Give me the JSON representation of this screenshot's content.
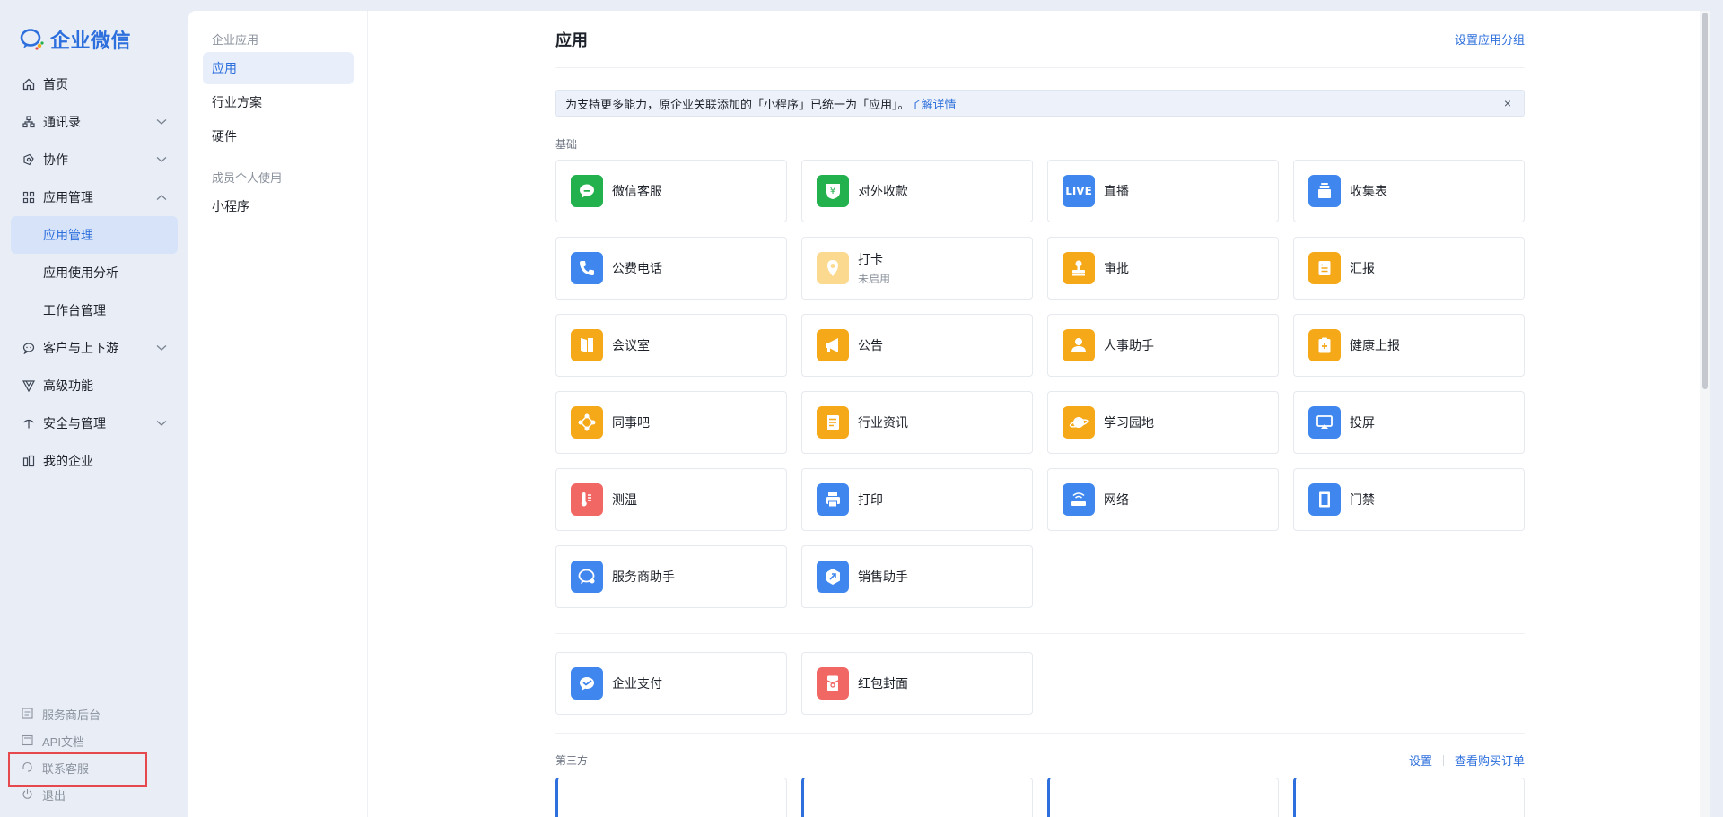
{
  "app": {
    "logo_text": "企业微信"
  },
  "sidebar": {
    "items": [
      {
        "label": "首页",
        "icon": "home-icon"
      },
      {
        "label": "通讯录",
        "icon": "contacts-icon",
        "expandable": true
      },
      {
        "label": "协作",
        "icon": "collaboration-icon",
        "expandable": true
      },
      {
        "label": "应用管理",
        "icon": "apps-icon",
        "expandable": true,
        "expanded": true
      },
      {
        "label": "应用管理",
        "sub": true,
        "active": true
      },
      {
        "label": "应用使用分析",
        "sub": true
      },
      {
        "label": "工作台管理",
        "sub": true
      },
      {
        "label": "客户与上下游",
        "icon": "customer-icon",
        "expandable": true
      },
      {
        "label": "高级功能",
        "icon": "advanced-icon"
      },
      {
        "label": "安全与管理",
        "icon": "security-icon",
        "expandable": true
      },
      {
        "label": "我的企业",
        "icon": "enterprise-icon"
      }
    ],
    "footer": [
      {
        "label": "服务商后台",
        "icon": "provider-icon"
      },
      {
        "label": "API文档",
        "icon": "api-doc-icon"
      },
      {
        "label": "联系客服",
        "icon": "headset-icon"
      },
      {
        "label": "退出",
        "icon": "power-icon"
      }
    ]
  },
  "subpanel": {
    "group1": "企业应用",
    "items1": [
      "应用",
      "行业方案",
      "硬件"
    ],
    "group2": "成员个人使用",
    "items2": [
      "小程序"
    ]
  },
  "main": {
    "title": "应用",
    "group_setting_link": "设置应用分组",
    "notice": {
      "text": "为支持更多能力，原企业关联添加的「小程序」已统一为「应用」。",
      "link": "了解详情",
      "close": "×"
    },
    "basic_label": "基础",
    "basic_apps": [
      {
        "name": "微信客服",
        "color": "#22b14c",
        "icon": "chat-bubble-icon"
      },
      {
        "name": "对外收款",
        "color": "#22b14c",
        "icon": "yuan-shield-icon"
      },
      {
        "name": "直播",
        "color": "#3f87ee",
        "icon": "live-icon",
        "badge": "LIVE"
      },
      {
        "name": "收集表",
        "color": "#3f87ee",
        "icon": "form-box-icon"
      },
      {
        "name": "公费电话",
        "color": "#3f87ee",
        "icon": "phone-icon"
      },
      {
        "name": "打卡",
        "sub": "未启用",
        "color": "#fbd98f",
        "icon": "location-pin-icon"
      },
      {
        "name": "审批",
        "color": "#f5a818",
        "icon": "stamp-icon"
      },
      {
        "name": "汇报",
        "color": "#f5a818",
        "icon": "report-icon"
      },
      {
        "name": "会议室",
        "color": "#f5a818",
        "icon": "door-icon"
      },
      {
        "name": "公告",
        "color": "#f5a818",
        "icon": "megaphone-icon"
      },
      {
        "name": "人事助手",
        "color": "#f5a818",
        "icon": "person-icon"
      },
      {
        "name": "健康上报",
        "color": "#f5a818",
        "icon": "health-icon"
      },
      {
        "name": "同事吧",
        "color": "#f5a818",
        "icon": "network-icon"
      },
      {
        "name": "行业资讯",
        "color": "#f5a818",
        "icon": "news-icon"
      },
      {
        "name": "学习园地",
        "color": "#f5a818",
        "icon": "planet-icon"
      },
      {
        "name": "投屏",
        "color": "#3f87ee",
        "icon": "screen-cast-icon"
      },
      {
        "name": "测温",
        "color": "#f16764",
        "icon": "thermometer-icon"
      },
      {
        "name": "打印",
        "color": "#3f87ee",
        "icon": "printer-icon"
      },
      {
        "name": "网络",
        "color": "#3f87ee",
        "icon": "router-icon"
      },
      {
        "name": "门禁",
        "color": "#3f87ee",
        "icon": "door-access-icon"
      },
      {
        "name": "服务商助手",
        "color": "#3f87ee",
        "icon": "service-chat-icon"
      },
      {
        "name": "销售助手",
        "color": "#3f87ee",
        "icon": "sales-icon"
      }
    ],
    "extra_apps": [
      {
        "name": "企业支付",
        "color": "#3f87ee",
        "icon": "payment-icon"
      },
      {
        "name": "红包封面",
        "color": "#f16764",
        "icon": "red-envelope-icon"
      }
    ],
    "third_party": {
      "label": "第三方",
      "settings_link": "设置",
      "orders_link": "查看购买订单"
    }
  }
}
